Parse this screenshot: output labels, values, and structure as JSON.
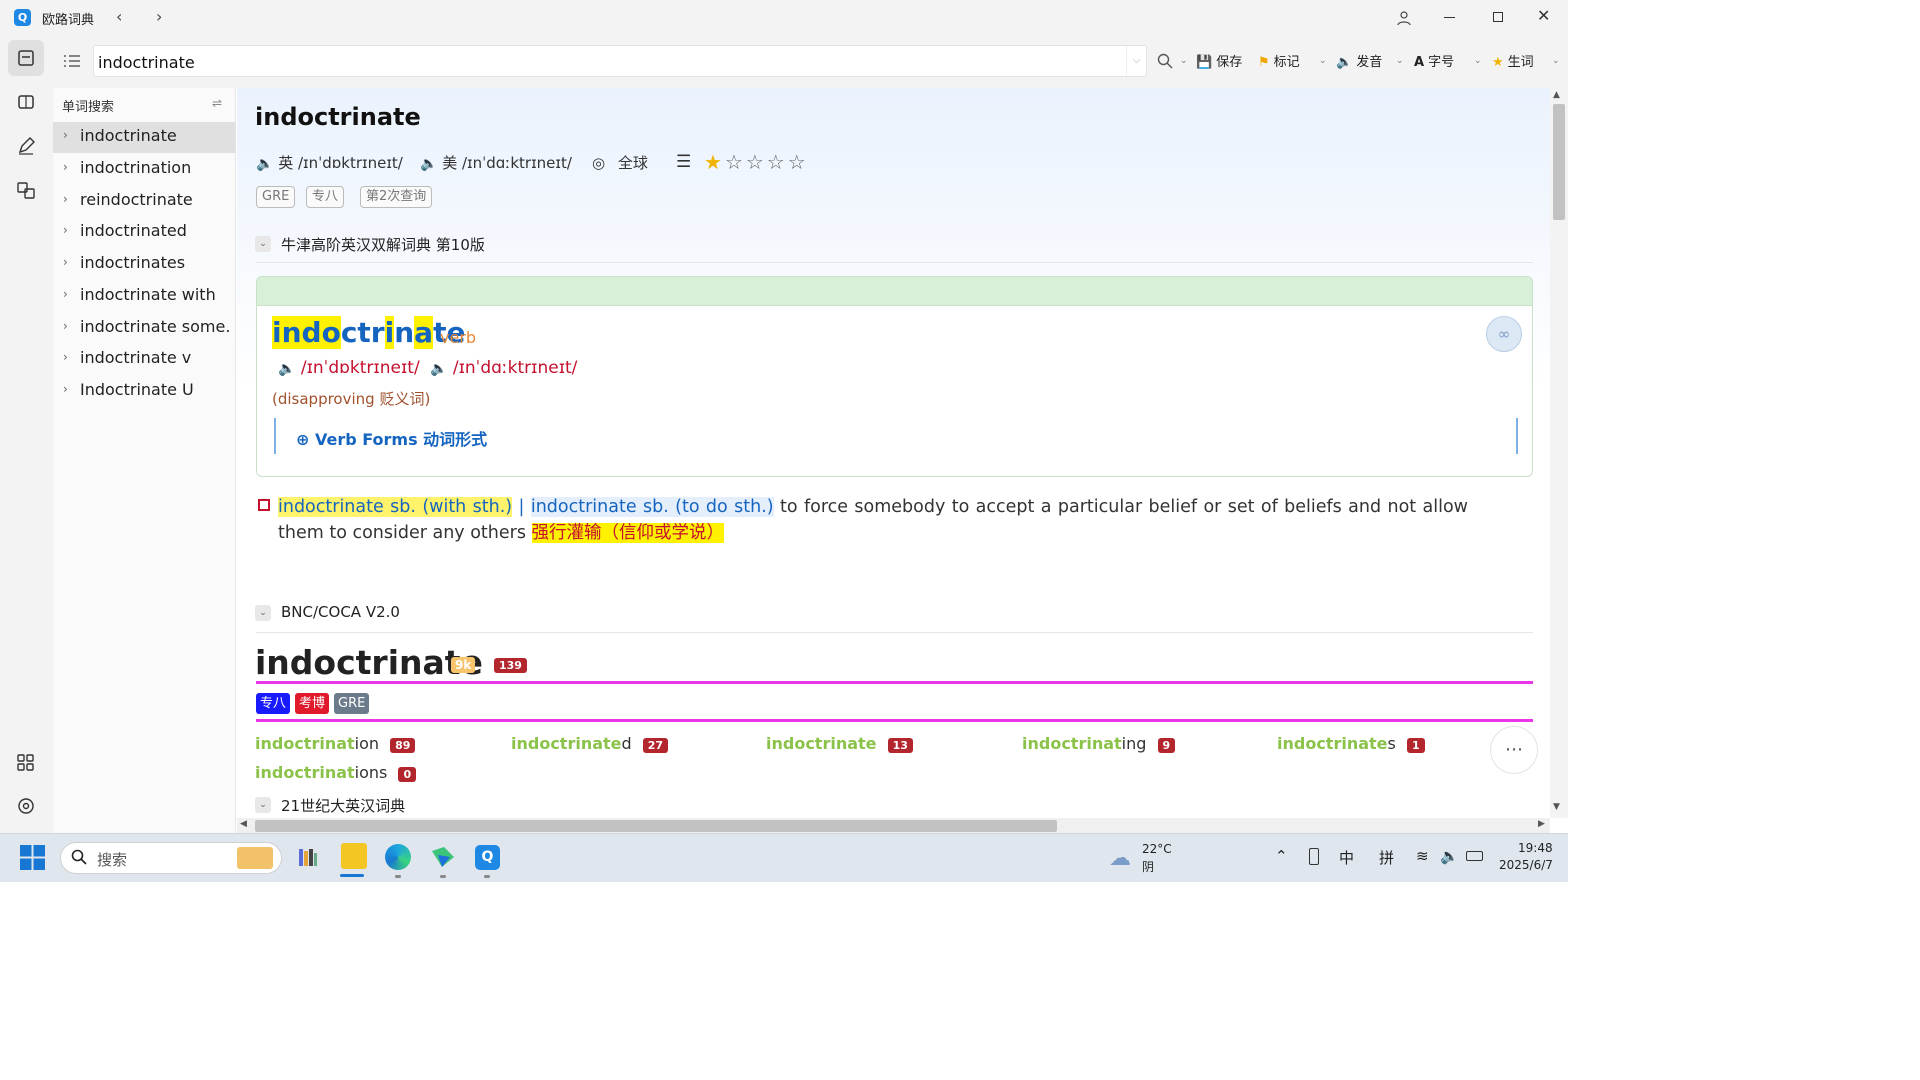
{
  "window": {
    "title": "欧路词典"
  },
  "toolbar": {
    "search_value": "indoctrinate",
    "save": "保存",
    "mark": "标记",
    "pronounce": "发音",
    "font": "字号",
    "vocab": "生词"
  },
  "sidebar": {
    "title": "单词搜索",
    "items": [
      "indoctrinate",
      "indoctrination",
      "reindoctrinate",
      "indoctrinated",
      "indoctrinates",
      "indoctrinate with",
      "indoctrinate some...",
      "indoctrinate v",
      "Indoctrinate U"
    ]
  },
  "entry": {
    "headword": "indoctrinate",
    "uk": "英 /ɪnˈdɒktrɪneɪt/",
    "us": "美 /ɪnˈdɑːktrɪneɪt/",
    "global": "全球",
    "tags": [
      "GRE",
      "专八",
      "第2次查询"
    ],
    "stars_filled": 1,
    "stars_total": 5
  },
  "oxford": {
    "section_title": "牛津高阶英汉双解词典 第10版",
    "word_parts": [
      "ind",
      "o",
      "ctr",
      "i",
      "n",
      "a",
      "te"
    ],
    "pos": "verb",
    "uk_pron": "/ɪnˈdɒktrɪneɪt/",
    "us_pron": "/ɪnˈdɑːktrɪneɪt/",
    "label": "(disapproving 贬义词)",
    "verb_forms": "⊕ Verb Forms 动词形式",
    "pattern1": "indoctrinate sb. (with sth.)",
    "sep": " | ",
    "pattern2": "indoctrinate sb. (to do sth.)",
    "definition": " to force somebody to accept a particular belief or set of beliefs and not allow them to consider any others ",
    "translation": "强行灌输（信仰或学说）"
  },
  "bnc": {
    "section_title": "BNC/COCA V2.0",
    "headword": "indoctrinate",
    "freq_badge": "9k",
    "count_badge": "139",
    "exam_tags": [
      {
        "label": "专八",
        "color": "#1a1aff"
      },
      {
        "label": "考博",
        "color": "#e0192b"
      },
      {
        "label": "GRE",
        "color": "#6c7b8b"
      }
    ],
    "forms": [
      {
        "stem": "indoctrinat",
        "suffix": "ion",
        "count": "89"
      },
      {
        "stem": "indoctrinate",
        "suffix": "d",
        "count": "27"
      },
      {
        "stem": "indoctrinate",
        "suffix": "",
        "count": "13"
      },
      {
        "stem": "indoctrinat",
        "suffix": "ing",
        "count": "9"
      },
      {
        "stem": "indoctrinate",
        "suffix": "s",
        "count": "1"
      },
      {
        "stem": "indoctrinat",
        "suffix": "ions",
        "count": "0"
      }
    ]
  },
  "section3_title": "21世纪大英汉词典",
  "taskbar": {
    "search_placeholder": "搜索",
    "weather_temp": "22°C",
    "weather_desc": "阴",
    "ime1": "中",
    "ime2": "拼",
    "time": "19:48",
    "date": "2025/6/7"
  },
  "colors": {
    "accent": "#1565c0",
    "highlight": "#fff200",
    "magenta": "#ea35e8",
    "pron": "#c4112f"
  }
}
